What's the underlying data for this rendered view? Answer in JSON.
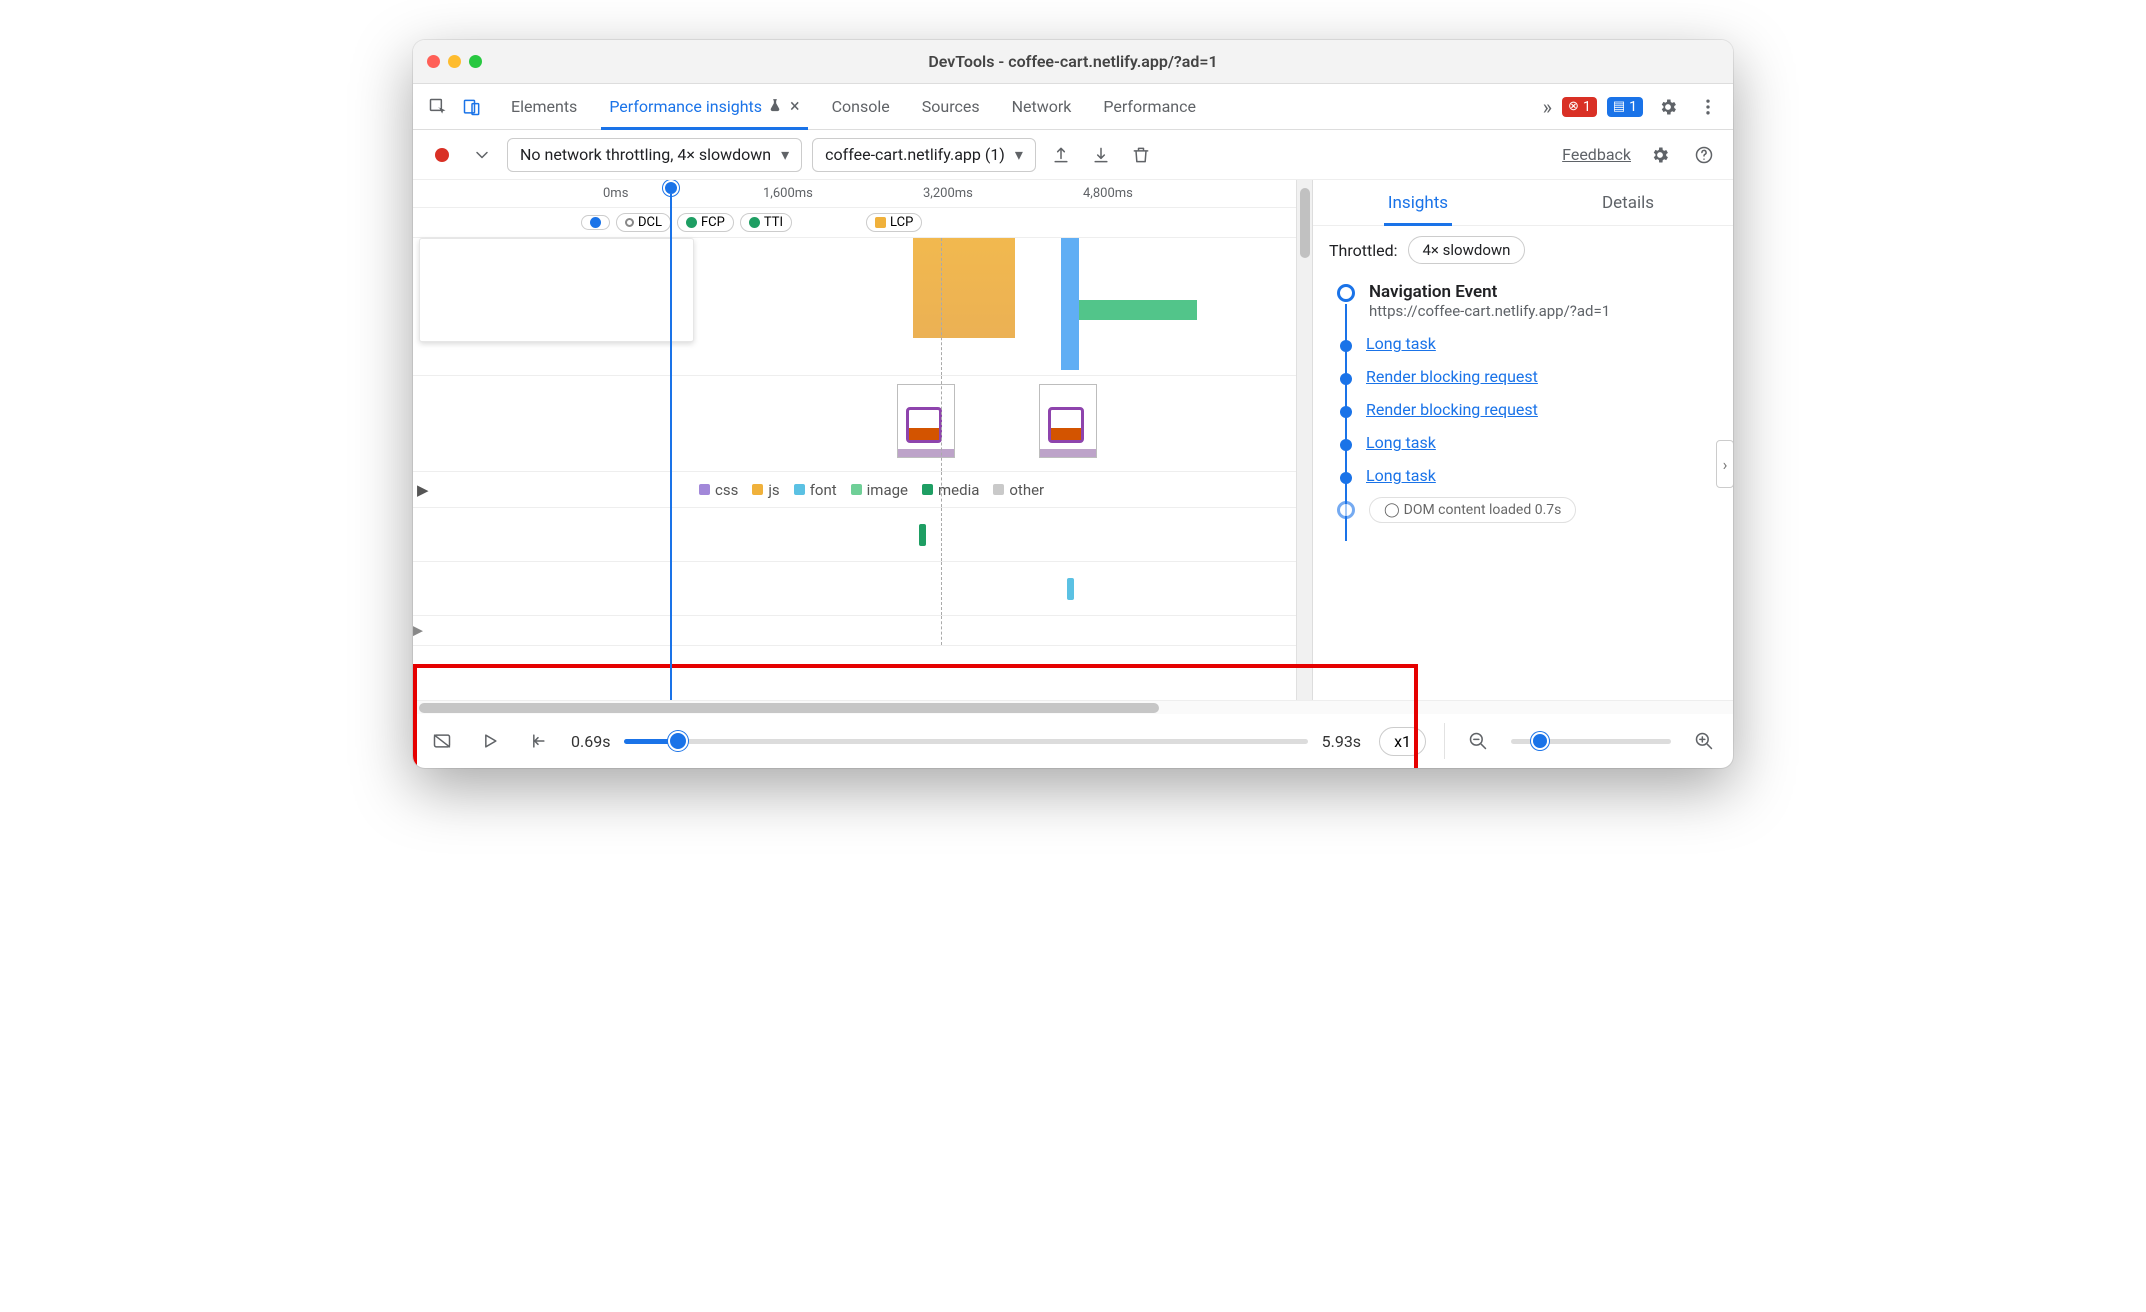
{
  "window": {
    "title": "DevTools - coffee-cart.netlify.app/?ad=1"
  },
  "tabs": {
    "elements": "Elements",
    "performance_insights": "Performance insights",
    "console": "Console",
    "sources": "Sources",
    "network": "Network",
    "performance": "Performance"
  },
  "badges": {
    "error_count": "1",
    "message_count": "1"
  },
  "toolbar": {
    "throttling_select": "No network throttling, 4× slowdown",
    "page_select": "coffee-cart.netlify.app (1)",
    "feedback": "Feedback"
  },
  "ruler": {
    "t0": "0ms",
    "t1": "1,600ms",
    "t2": "3,200ms",
    "t3": "4,800ms"
  },
  "markers": {
    "dcl": "DCL",
    "fcp": "FCP",
    "tti": "TTI",
    "lcp": "LCP"
  },
  "legend": {
    "css": "css",
    "js": "js",
    "font": "font",
    "image": "image",
    "media": "media",
    "other": "other"
  },
  "sidebar": {
    "tab_insights": "Insights",
    "tab_details": "Details",
    "throttled_label": "Throttled:",
    "throttled_value": "4× slowdown",
    "nav_title": "Navigation Event",
    "nav_url": "https://coffee-cart.netlify.app/?ad=1",
    "items": [
      "Long task",
      "Render blocking request",
      "Render blocking request",
      "Long task",
      "Long task"
    ],
    "dcl_chip": "DOM content loaded 0.7s"
  },
  "footer": {
    "start_time": "0.69s",
    "end_time": "5.93s",
    "speed": "x1"
  },
  "colors": {
    "css": "#a288d9",
    "js": "#f0b13b",
    "font": "#5bc1e3",
    "image": "#6fcf97",
    "media": "#1e9e63",
    "other": "#c9c9c9"
  }
}
